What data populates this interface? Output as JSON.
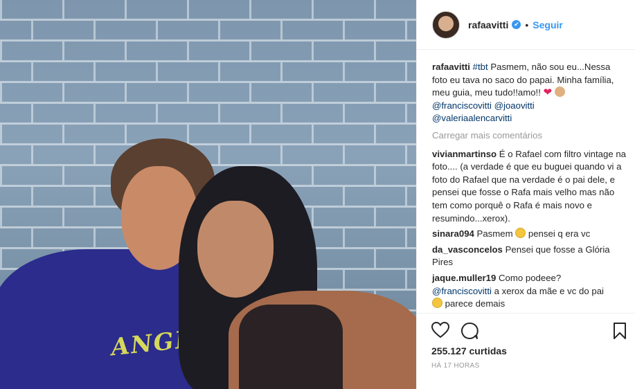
{
  "post": {
    "author": "rafaavitti",
    "follow_label": "Seguir",
    "dot": "•",
    "verified_glyph": "✔"
  },
  "photo": {
    "shirt_text": "ANGELS IN"
  },
  "caption": {
    "username": "rafaavitti",
    "hashtag": "#tbt",
    "text": " Pasmem, não sou eu...Nessa foto eu tava no saco do papai. Minha família, meu guia, meu tudo!!amo!! ",
    "heart": "❤",
    "mentions": [
      "@franciscovitti",
      "@joaovitti",
      "@valeriaalencarvitti"
    ]
  },
  "load_more": "Carregar mais comentários",
  "comments": [
    {
      "username": "vivianmartinso",
      "text": " É o Rafael com filtro vintage na foto.... (a verdade é que eu buguei quando vi a foto do Rafael que na verdade é o pai dele, e pensei que fosse o Rafa mais velho mas não tem como porquê o Rafa é mais novo e resumindo...xerox)."
    },
    {
      "username": "sinara094",
      "text_before": " Pasmem ",
      "text_after": " pensei q era vc"
    },
    {
      "username": "da_vasconcelos",
      "text": " Pensei que fosse a Glória Pires"
    },
    {
      "username": "jaque.muller19",
      "text": " Como podeee?",
      "mention": "@franciscovitti",
      "text2": " a xerox da mãe e vc do pai ",
      "text3": " parece demais"
    }
  ],
  "likes": "255.127 curtidas",
  "timestamp": "HÁ 17 HORAS",
  "icons": {
    "like": "heart-icon",
    "comment": "comment-icon",
    "save": "bookmark-icon"
  },
  "colors": {
    "link": "#003569",
    "accent": "#3897f0",
    "muted": "#999999"
  }
}
